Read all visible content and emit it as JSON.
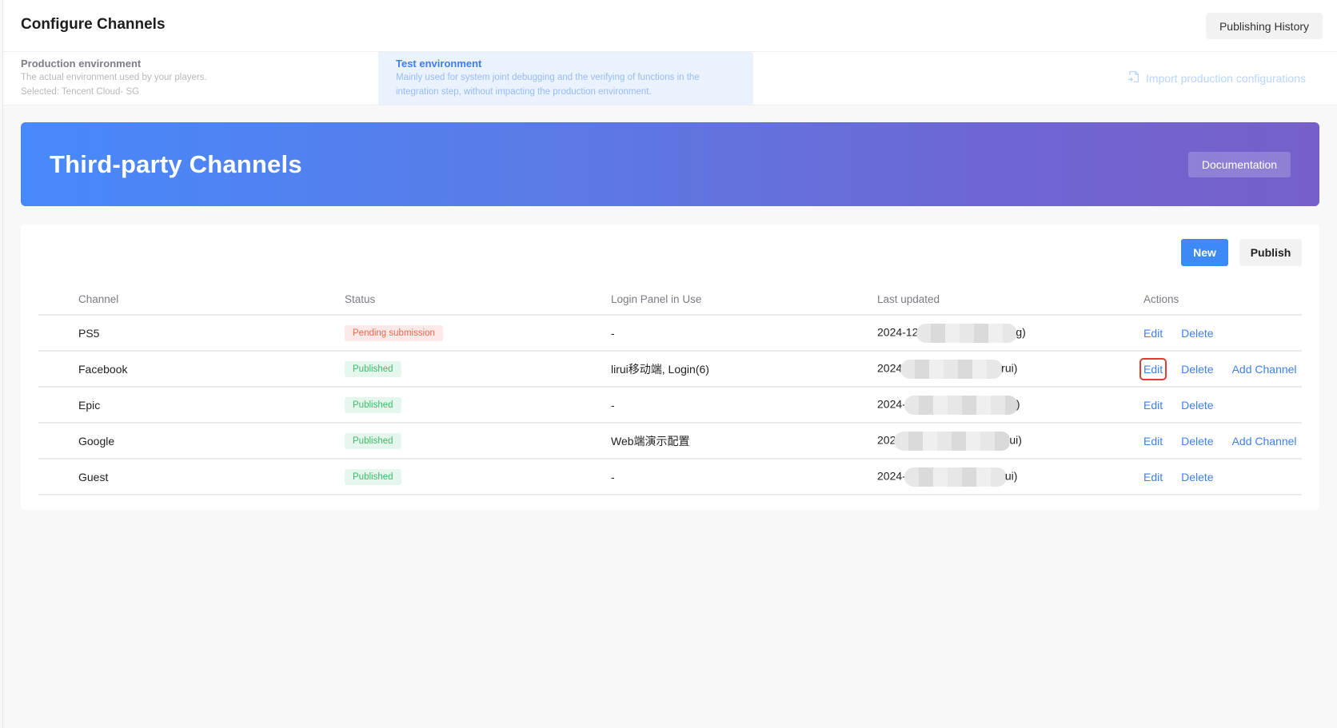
{
  "header": {
    "title": "Configure Channels",
    "publishing_history_label": "Publishing History"
  },
  "environments": {
    "production": {
      "name": "Production environment",
      "description": "The actual environment used by your players.",
      "selected": "Selected: Tencent Cloud- SG"
    },
    "test": {
      "name": "Test environment",
      "description_line1": "Mainly used for system joint debugging and the verifying of functions in the",
      "description_line2": "integration step, without impacting the production environment.",
      "active": true
    },
    "import_label": "Import production configurations",
    "import_icon": "file-import-icon"
  },
  "banner": {
    "title": "Third-party Channels",
    "documentation_label": "Documentation"
  },
  "toolbar": {
    "new_label": "New",
    "publish_label": "Publish"
  },
  "table": {
    "columns": [
      "Channel",
      "Status",
      "Login Panel in Use",
      "Last updated",
      "Actions"
    ],
    "rows": [
      {
        "channel": "PS5",
        "status": "Pending submission",
        "status_type": "pending",
        "login_panel": "-",
        "last_updated_prefix": "2024-12",
        "last_updated_suffix": "g)",
        "actions": [
          "Edit",
          "Delete"
        ]
      },
      {
        "channel": "Facebook",
        "status": "Published",
        "status_type": "published",
        "login_panel": "lirui移动端, Login(6)",
        "last_updated_prefix": "2024",
        "last_updated_suffix": "rui)",
        "actions": [
          "Edit",
          "Delete",
          "Add Channel"
        ],
        "highlighted_action": "Edit"
      },
      {
        "channel": "Epic",
        "status": "Published",
        "status_type": "published",
        "login_panel": "-",
        "last_updated_prefix": "2024-",
        "last_updated_suffix": ")",
        "actions": [
          "Edit",
          "Delete"
        ]
      },
      {
        "channel": "Google",
        "status": "Published",
        "status_type": "published",
        "login_panel": "Web端演示配置",
        "last_updated_prefix": "202",
        "last_updated_suffix": "ui)",
        "actions": [
          "Edit",
          "Delete",
          "Add Channel"
        ]
      },
      {
        "channel": "Guest",
        "status": "Published",
        "status_type": "published",
        "login_panel": "-",
        "last_updated_prefix": "2024-",
        "last_updated_suffix": "ui)",
        "actions": [
          "Edit",
          "Delete"
        ]
      }
    ]
  },
  "colors": {
    "primary": "#3d8af7",
    "link": "#3d7ff5",
    "pending_text": "#f0684c",
    "pending_bg": "#fde9e7",
    "published_text": "#3dbb6a",
    "published_bg": "#e5f7ec",
    "highlight_outline": "#e53935",
    "banner_gradient_start": "#4789fb",
    "banner_gradient_end": "#775fc9"
  }
}
